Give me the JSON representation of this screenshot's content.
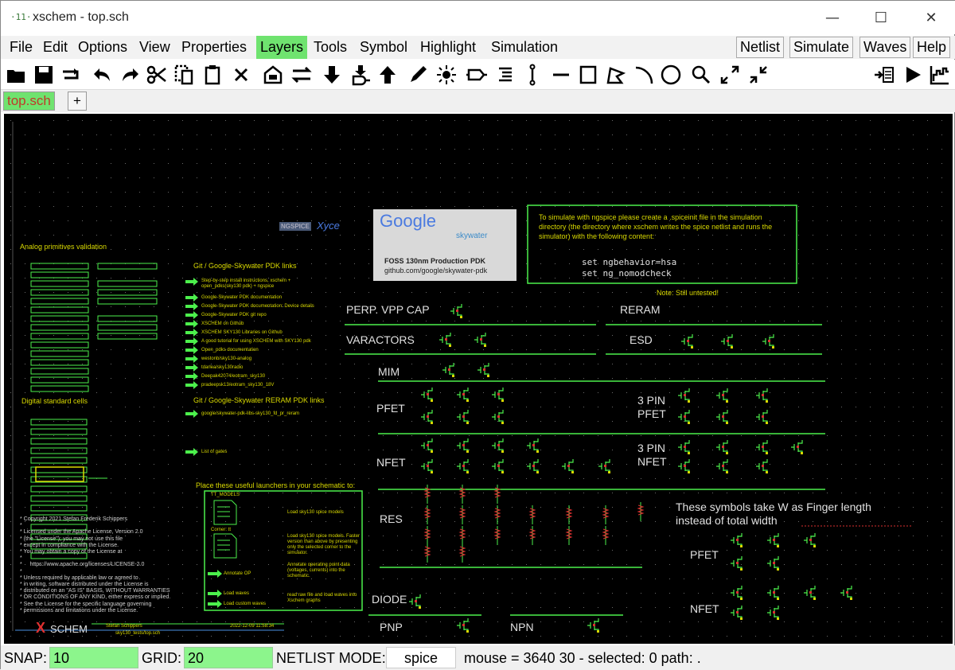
{
  "window": {
    "title": "xschem - top.sch",
    "app_icon_glyph": "·11·"
  },
  "window_controls": {
    "minimize": "—",
    "maximize": "☐",
    "close": "✕"
  },
  "menu": {
    "left": [
      "File",
      "Edit",
      "Options",
      "View",
      "Properties",
      "Layers",
      "Tools",
      "Symbol",
      "Highlight",
      "Simulation"
    ],
    "right": [
      "Netlist",
      "Simulate",
      "Waves",
      "Help"
    ],
    "active": "Layers"
  },
  "toolbar": {
    "icons": [
      "open-icon",
      "save-icon",
      "reload-icon",
      "undo-icon",
      "redo-icon",
      "cut-icon",
      "copy-icon",
      "paste-icon",
      "delete-icon",
      "place-symbol-icon",
      "wire-swap-icon",
      "push-down-icon",
      "make-symbol-icon",
      "pop-up-icon",
      "pencil-icon",
      "highlight-icon",
      "pin-icon",
      "netlabel-icon",
      "net-icon",
      "line-icon",
      "rect-icon",
      "polygon-icon",
      "arc-icon",
      "circle-icon",
      "zoom-icon",
      "zoom-in-icon",
      "zoom-out-icon",
      "netlist-icon",
      "simulate-icon",
      "waves-icon"
    ]
  },
  "tabs": {
    "active": "top.sch",
    "add": "+"
  },
  "canvas": {
    "sections": {
      "analog_title": "Analog primitives validation",
      "digital_title": "Digital standard cells",
      "git_links_title": "Git / Google-Skywater PDK links",
      "reram_links_title": "Git / Google-Skywater RERAM PDK links",
      "launchers_title": "Place these useful launchers in your schematic to:"
    },
    "git_links": [
      "Step-by-step install instructions, xschem + open_pdks(sky130 pdk) + ngspice",
      "Google-Skywater PDK documentation",
      "Google-Skywater PDK documentation: Device details",
      "Google-Skywater PDK git repo",
      "XSCHEM on Github",
      "XSCHEM SKY130 Libraries on Github",
      "A good tutorial for using XSCHEM with SKY130 pdk",
      "Open_pdks documentation",
      "westonb/sky130-analog",
      "tdarlea/sky130radio",
      "Deepak42074/eotram_sky130",
      "pradeepsk13/eotram_sky130_18V"
    ],
    "reram_links": [
      "google/skywater-pdk-libs-sky130_fd_pr_reram"
    ],
    "gates_link": "List of gates",
    "launchers": [
      "Load sky130 spice models",
      "Load sky130 spice models. Faster version than above by presenting only the selected corner to the simulator.",
      "Annotate operating point data (voltages, currents) into the schematic.",
      "read raw file and load waves into Xschem graphs"
    ],
    "launcher_buttons": [
      "TT_MODELS",
      "Corner: tt",
      "Annotate OP",
      "Load waves",
      "Load custom waves"
    ],
    "pdk_box": {
      "google": "Google",
      "skywater": "skywater",
      "line1": "FOSS 130nm Production PDK",
      "line2": "github.com/google/skywater-pdk"
    },
    "logos": {
      "ngspice": "NGSPICE",
      "xyce": "Xyce"
    },
    "sim_note": {
      "text": "To simulate with ngspice please create a .spiceinit file in the simulation directory (the directory where xschem writes the spice netlist and runs the simulator) with the following content:",
      "cmd1": "set ngbehavior=hsa",
      "cmd2": "set ng_nomodcheck"
    },
    "untested": "Note: Still untested!",
    "labels": {
      "perp_vpp_cap": "PERP. VPP CAP",
      "reram": "RERAM",
      "varactors": "VARACTORS",
      "esd": "ESD",
      "mim": "MIM",
      "pfet": "PFET",
      "nfet": "NFET",
      "pin3_pfet": "3 PIN\nPFET",
      "pin3_nfet": "3 PIN\nNFET",
      "res": "RES",
      "diode": "DIODE",
      "pnp": "PNP",
      "npn": "NPN",
      "finger_note": "These symbols take W as Finger length\ninstead of total width",
      "finger_pfet": "PFET",
      "finger_nfet": "NFET"
    },
    "license": "* Copyright 2021 Stefan Frederik Schippers\n*\n* Licensed under the Apache License, Version 2.0\n* (the \"License\"); you may not use this file\n* except in compliance with the License.\n* You may obtain a copy of the License at\n*\n*     https://www.apache.org/licenses/LICENSE-2.0\n*\n* Unless required by applicable law or agreed to\n* in writing, software distributed under the License is\n* distributed on an \"AS IS\" BASIS, WITHOUT WARRANTIES\n* OR CONDITIONS OF ANY KIND, either express or implied.\n* See the License for the specific language governing\n* permissions and limitations under the License.",
    "title_block": {
      "logo_x": "X",
      "logo_text": "SCHEM",
      "author": "Stefan Schippers",
      "file": "sky130_tests/top.sch",
      "date": "2022-12-09 11:58:34"
    }
  },
  "status": {
    "snap_label": "SNAP:",
    "snap": "10",
    "grid_label": "GRID:",
    "grid": "20",
    "netlist_label": "NETLIST MODE:",
    "netlist_mode": "spice",
    "mouse": "mouse = 3640 30 - selected: 0 path: ."
  },
  "colors": {
    "menu_active": "#6fe36f",
    "canvas_bg": "#000000",
    "wire": "#4cf04c",
    "label": "#d9d900",
    "status_field": "#8cf58c"
  }
}
